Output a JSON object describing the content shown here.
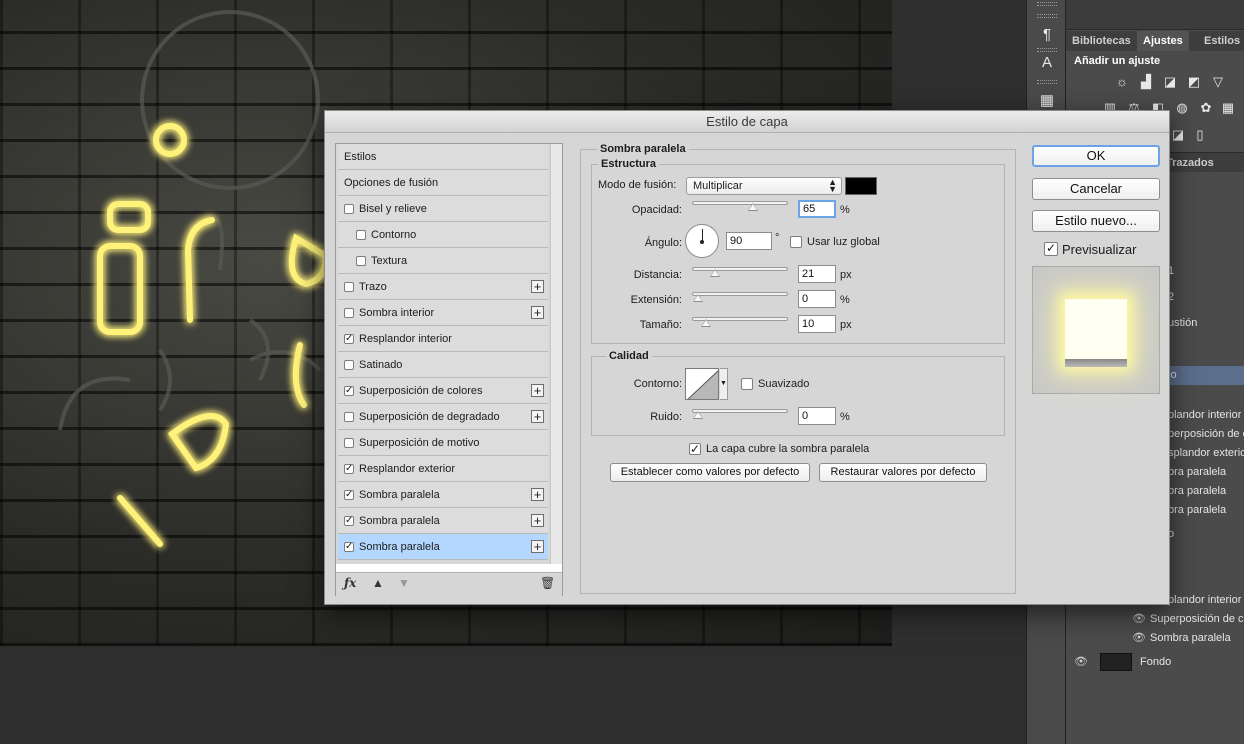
{
  "right_panel": {
    "tabs": [
      "Bibliotecas",
      "Ajustes",
      "Estilos"
    ],
    "active_tab": "Ajustes",
    "adjustments_title": "Añadir un ajuste",
    "paths_tab": "Trazados",
    "layer_rows": [
      {
        "text": "1",
        "selected": false
      },
      {
        "text": "2",
        "selected": false
      },
      {
        "text": "ustión",
        "selected": false
      },
      {
        "text": "lo",
        "selected": true
      },
      {
        "text": "plandor interior",
        "selected": false
      },
      {
        "text": "perposición de c",
        "selected": false
      },
      {
        "text": "splandor exterior",
        "selected": false
      },
      {
        "text": "bra paralela",
        "selected": false
      },
      {
        "text": "bra paralela",
        "selected": false
      },
      {
        "text": "bra paralela",
        "selected": false
      },
      {
        "text": "o",
        "selected": false
      },
      {
        "text": "plandor interior",
        "selected": false
      },
      {
        "text": "Superposición de c",
        "selected": false
      },
      {
        "text": "Sombra paralela",
        "selected": false
      },
      {
        "text": "Fondo",
        "selected": false
      }
    ]
  },
  "dialog": {
    "title": "Estilo de capa",
    "styles": [
      {
        "label": "Estilos",
        "checkbox": null,
        "plus": false,
        "indent": 0,
        "selected": false
      },
      {
        "label": "Opciones de fusión",
        "checkbox": null,
        "plus": false,
        "indent": 0,
        "selected": false
      },
      {
        "label": "Bisel y relieve",
        "checkbox": false,
        "plus": false,
        "indent": 0,
        "selected": false
      },
      {
        "label": "Contorno",
        "checkbox": false,
        "plus": false,
        "indent": 1,
        "selected": false
      },
      {
        "label": "Textura",
        "checkbox": false,
        "plus": false,
        "indent": 1,
        "selected": false
      },
      {
        "label": "Trazo",
        "checkbox": false,
        "plus": true,
        "indent": 0,
        "selected": false
      },
      {
        "label": "Sombra interior",
        "checkbox": false,
        "plus": true,
        "indent": 0,
        "selected": false
      },
      {
        "label": "Resplandor interior",
        "checkbox": true,
        "plus": false,
        "indent": 0,
        "selected": false
      },
      {
        "label": "Satinado",
        "checkbox": false,
        "plus": false,
        "indent": 0,
        "selected": false
      },
      {
        "label": "Superposición de colores",
        "checkbox": true,
        "plus": true,
        "indent": 0,
        "selected": false
      },
      {
        "label": "Superposición de degradado",
        "checkbox": false,
        "plus": true,
        "indent": 0,
        "selected": false
      },
      {
        "label": "Superposición de motivo",
        "checkbox": false,
        "plus": false,
        "indent": 0,
        "selected": false
      },
      {
        "label": "Resplandor exterior",
        "checkbox": true,
        "plus": false,
        "indent": 0,
        "selected": false
      },
      {
        "label": "Sombra paralela",
        "checkbox": true,
        "plus": true,
        "indent": 0,
        "selected": false
      },
      {
        "label": "Sombra paralela",
        "checkbox": true,
        "plus": true,
        "indent": 0,
        "selected": false
      },
      {
        "label": "Sombra paralela",
        "checkbox": true,
        "plus": true,
        "indent": 0,
        "selected": true
      }
    ],
    "footer_icons": [
      "fx-icon",
      "arrow-up-icon",
      "arrow-down-icon",
      "trash-icon"
    ],
    "section_title": "Sombra paralela",
    "structure": {
      "title": "Estructura",
      "blend_mode_label": "Modo de fusión:",
      "blend_mode_value": "Multiplicar",
      "shadow_color": "#000000",
      "opacity_label": "Opacidad:",
      "opacity_value": "65",
      "opacity_unit": "%",
      "opacity_fraction": 0.65,
      "angle_label": "Ángulo:",
      "angle_value": "90",
      "angle_unit": "°",
      "global_light_label": "Usar luz global",
      "global_light_checked": false,
      "distance_label": "Distancia:",
      "distance_value": "21",
      "distance_unit": "px",
      "distance_fraction": 0.2,
      "spread_label": "Extensión:",
      "spread_value": "0",
      "spread_unit": "%",
      "spread_fraction": 0.0,
      "size_label": "Tamaño:",
      "size_value": "10",
      "size_unit": "px",
      "size_fraction": 0.09
    },
    "quality": {
      "title": "Calidad",
      "contour_label": "Contorno:",
      "antialias_label": "Suavizado",
      "antialias_checked": false,
      "noise_label": "Ruido:",
      "noise_value": "0",
      "noise_unit": "%",
      "noise_fraction": 0.0
    },
    "knockout_label": "La capa cubre la sombra paralela",
    "knockout_checked": true,
    "set_default_label": "Establecer como valores por defecto",
    "reset_default_label": "Restaurar valores por defecto",
    "ok_label": "OK",
    "cancel_label": "Cancelar",
    "new_style_label": "Estilo nuevo...",
    "preview_label": "Previsualizar",
    "preview_checked": true
  }
}
